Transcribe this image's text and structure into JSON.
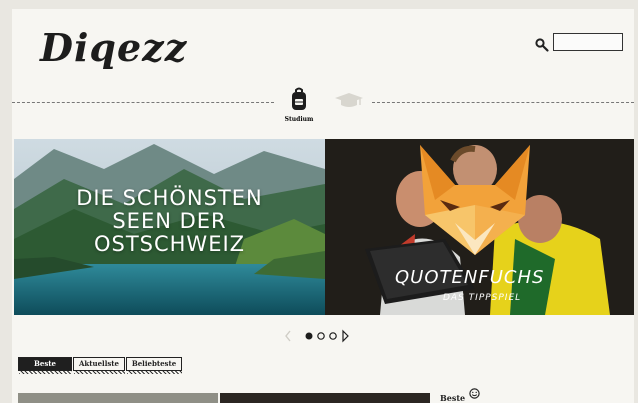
{
  "header": {
    "logo_text": "Diqezz",
    "search_placeholder": ""
  },
  "nav": [
    {
      "label": "Studium",
      "icon": "backpack-icon",
      "active": true
    },
    {
      "label": "",
      "icon": "graduation-cap-icon",
      "active": false
    }
  ],
  "slides": [
    {
      "title_lines": [
        "DIE SCHÖNSTEN",
        "SEEN DER",
        "OSTSCHWEIZ"
      ]
    },
    {
      "title": "QUOTENFUCHS",
      "subtitle": "DAS TIPPSPIEL"
    }
  ],
  "tabs": [
    {
      "label": "Beste",
      "active": true
    },
    {
      "label": "Aktuellste",
      "active": false
    },
    {
      "label": "Beliebteste",
      "active": false
    }
  ],
  "sidebar": {
    "label": "Beste"
  },
  "colors": {
    "background": "#f7f6f2",
    "ink": "#1d1d1d",
    "fox_orange": "#f2a23a"
  }
}
